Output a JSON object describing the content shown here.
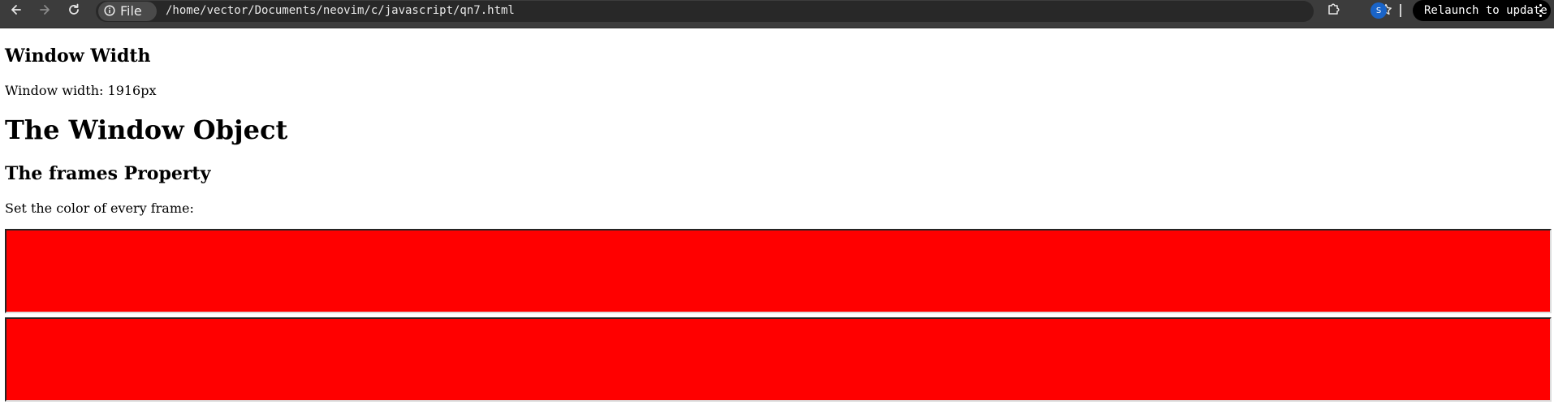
{
  "browser": {
    "chip_label": "File",
    "url": "/home/vector/Documents/neovim/c/javascript/qn7.html",
    "profile_initial": "S",
    "relaunch_label": "Relaunch to update",
    "colors": {
      "toolbar": "#3c3c3c",
      "omnibox": "#282828",
      "avatar": "#1a64c8",
      "relaunch": "#000000"
    }
  },
  "page": {
    "width_heading": "Window Width",
    "width_text": "Window width: 1916px",
    "title": "The Window Object",
    "frames_heading": "The frames Property",
    "frames_text": "Set the color of every frame:"
  },
  "frames": [
    {
      "color": "#ff0000"
    },
    {
      "color": "#ff0000"
    }
  ]
}
